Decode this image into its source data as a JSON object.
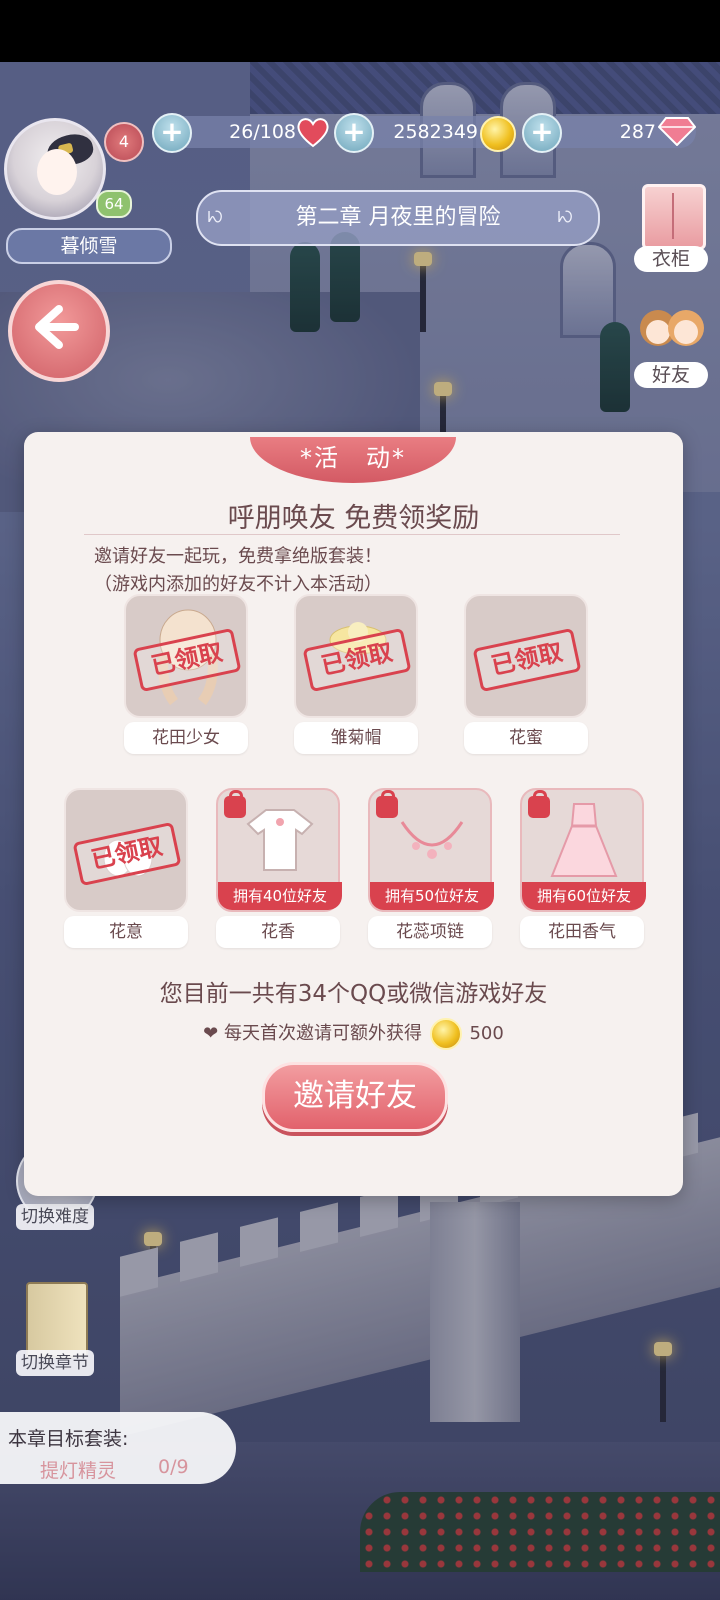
{
  "hud": {
    "player_name": "暮倾雪",
    "mail_count": "4",
    "level": "64",
    "stamina": "26/108",
    "coins": "2582349",
    "diamonds": "287",
    "chapter_title": "第二章 月夜里的冒险"
  },
  "side": {
    "wardrobe_label": "衣柜",
    "friends_label": "好友",
    "switch_difficulty_label": "切换难度",
    "switch_chapter_label": "切换章节"
  },
  "goal": {
    "title": "本章目标套装:",
    "suit_name": "提灯精灵",
    "progress": "0/9"
  },
  "dialog": {
    "tab": "*活　动*",
    "title": "呼朋唤友 免费领奖励",
    "line1": "邀请好友一起玩，免费拿绝版套装！",
    "line2": "（游戏内添加的好友不计入本活动）",
    "claimed_stamp": "已领取",
    "rewards_row1": [
      {
        "name": "花田少女",
        "status": "claimed"
      },
      {
        "name": "雏菊帽",
        "status": "claimed"
      },
      {
        "name": "花蜜",
        "status": "claimed"
      }
    ],
    "rewards_row2": [
      {
        "name": "花意",
        "status": "claimed",
        "requirement": ""
      },
      {
        "name": "花香",
        "status": "locked",
        "requirement": "拥有40位好友"
      },
      {
        "name": "花蕊项链",
        "status": "locked",
        "requirement": "拥有50位好友"
      },
      {
        "name": "花田香气",
        "status": "locked",
        "requirement": "拥有60位好友"
      }
    ],
    "friend_count_text": "您目前一共有34个QQ或微信游戏好友",
    "bonus_text": "每天首次邀请可额外获得",
    "bonus_amount": "500",
    "invite_button": "邀请好友"
  },
  "colors": {
    "accent_red": "#d9424e",
    "button_pink": "#e2626c",
    "dialog_bg": "#f6f1ef",
    "text_brown": "#6a4a4e"
  }
}
